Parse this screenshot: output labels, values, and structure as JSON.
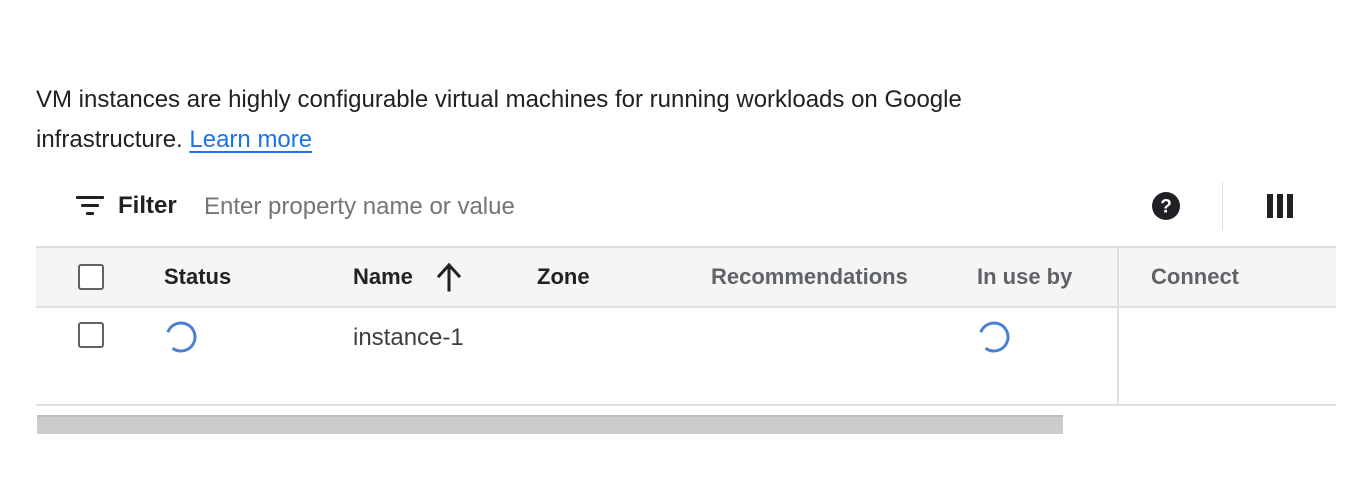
{
  "description": {
    "text": "VM instances are highly configurable virtual machines for running workloads on Google infrastructure.",
    "link_label": "Learn more"
  },
  "filter": {
    "label": "Filter",
    "placeholder": "Enter property name or value",
    "value": ""
  },
  "icons": {
    "filter": "filter-list-icon",
    "help": "help-circle-icon",
    "columns": "column-display-icon",
    "sort": "arrow-up-icon",
    "loading": "loading-spinner-icon"
  },
  "table": {
    "columns": {
      "status": "Status",
      "name": "Name",
      "zone": "Zone",
      "recommendations": "Recommendations",
      "in_use_by": "In use by",
      "connect": "Connect"
    },
    "sort": {
      "column": "Name",
      "direction": "ascending"
    },
    "rows": [
      {
        "status": "loading",
        "name": "instance-1",
        "zone": "",
        "recommendations": "",
        "in_use_by": "loading",
        "connect": ""
      }
    ]
  },
  "colors": {
    "link": "#1a73e8",
    "spinner": "#4a7fd6",
    "header_bg": "#f5f5f5",
    "border": "#e0e0e0",
    "scrollbar": "#cccccc"
  }
}
